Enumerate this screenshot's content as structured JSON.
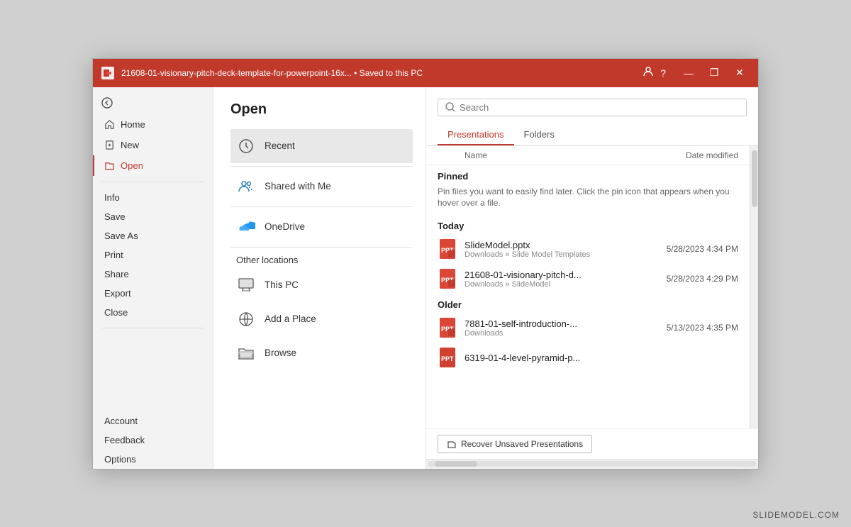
{
  "titlebar": {
    "title": "21608-01-visionary-pitch-deck-template-for-powerpoint-16x...  •  Saved to this PC",
    "question_label": "?",
    "minimize_label": "—",
    "maximize_label": "❐",
    "close_label": "✕"
  },
  "sidebar": {
    "back_label": "",
    "nav_items": [
      {
        "id": "home",
        "label": "Home",
        "icon": "home"
      },
      {
        "id": "new",
        "label": "New",
        "icon": "new-file"
      },
      {
        "id": "open",
        "label": "Open",
        "icon": "folder",
        "active": true
      }
    ],
    "sub_items": [
      {
        "id": "info",
        "label": "Info"
      },
      {
        "id": "save",
        "label": "Save"
      },
      {
        "id": "save-as",
        "label": "Save As"
      },
      {
        "id": "print",
        "label": "Print"
      },
      {
        "id": "share",
        "label": "Share"
      },
      {
        "id": "export",
        "label": "Export"
      },
      {
        "id": "close",
        "label": "Close"
      }
    ],
    "bottom_items": [
      {
        "id": "account",
        "label": "Account"
      },
      {
        "id": "feedback",
        "label": "Feedback"
      },
      {
        "id": "options",
        "label": "Options",
        "highlight": true
      }
    ]
  },
  "middle": {
    "title": "Open",
    "locations": [
      {
        "id": "recent",
        "label": "Recent",
        "icon": "clock",
        "selected": true
      },
      {
        "id": "shared",
        "label": "Shared with Me",
        "icon": "people"
      },
      {
        "id": "onedrive",
        "label": "OneDrive",
        "icon": "onedrive"
      }
    ],
    "other_label": "Other locations",
    "other_locations": [
      {
        "id": "thispc",
        "label": "This PC",
        "icon": "computer"
      },
      {
        "id": "addplace",
        "label": "Add a Place",
        "icon": "globe"
      },
      {
        "id": "browse",
        "label": "Browse",
        "icon": "folder-open"
      }
    ]
  },
  "right": {
    "search_placeholder": "Search",
    "tabs": [
      {
        "id": "presentations",
        "label": "Presentations",
        "active": true
      },
      {
        "id": "folders",
        "label": "Folders",
        "active": false
      }
    ],
    "columns": {
      "name": "Name",
      "date_modified": "Date modified"
    },
    "sections": [
      {
        "id": "pinned",
        "label": "Pinned",
        "description": "Pin files you want to easily find later. Click the pin icon that appears when you hover over a file.",
        "files": []
      },
      {
        "id": "today",
        "label": "Today",
        "files": [
          {
            "name": "SlideModel.pptx",
            "path": "Downloads » Slide Model Templates",
            "date": "5/28/2023 4:34 PM"
          },
          {
            "name": "21608-01-visionary-pitch-d...",
            "path": "Downloads » SlideModel",
            "date": "5/28/2023 4:29 PM"
          }
        ]
      },
      {
        "id": "older",
        "label": "Older",
        "files": [
          {
            "name": "7881-01-self-introduction-...",
            "path": "Downloads",
            "date": "5/13/2023 4:35 PM"
          },
          {
            "name": "6319-01-4-level-pyramid-p...",
            "path": "",
            "date": ""
          }
        ]
      }
    ],
    "recover_label": "Recover Unsaved Presentations"
  },
  "watermark": "SLIDEMODEL.COM"
}
